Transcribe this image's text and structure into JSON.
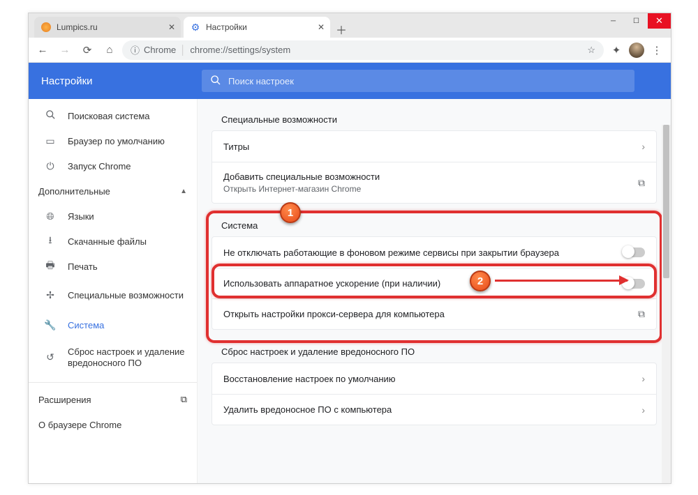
{
  "window": {
    "tabs": [
      {
        "title": "Lumpics.ru",
        "active": false
      },
      {
        "title": "Настройки",
        "active": true
      }
    ]
  },
  "toolbar": {
    "chrome_label": "Chrome",
    "url": "chrome://settings/system"
  },
  "header": {
    "title": "Настройки",
    "search_placeholder": "Поиск настроек"
  },
  "sidebar": {
    "items": [
      {
        "icon": "search",
        "label": "Поисковая система"
      },
      {
        "icon": "browser",
        "label": "Браузер по умолчанию"
      },
      {
        "icon": "power",
        "label": "Запуск Chrome"
      }
    ],
    "advanced_label": "Дополнительные",
    "advanced_items": [
      {
        "icon": "globe",
        "label": "Языки"
      },
      {
        "icon": "download",
        "label": "Скачанные файлы"
      },
      {
        "icon": "print",
        "label": "Печать"
      },
      {
        "icon": "a11y",
        "label": "Специальные возможности"
      },
      {
        "icon": "wrench",
        "label": "Система",
        "active": true
      },
      {
        "icon": "reset",
        "label": "Сброс настроек и удаление вредоносного ПО"
      }
    ],
    "extensions_label": "Расширения",
    "about_label": "О браузере Chrome"
  },
  "sections": {
    "accessibility": {
      "title": "Специальные возможности",
      "rows": [
        {
          "label": "Титры"
        },
        {
          "label": "Добавить специальные возможности",
          "sub": "Открыть Интернет-магазин Chrome"
        }
      ]
    },
    "system": {
      "title": "Система",
      "rows": [
        {
          "label": "Не отключать работающие в фоновом режиме сервисы при закрытии браузера"
        },
        {
          "label": "Использовать аппаратное ускорение (при наличии)"
        },
        {
          "label": "Открыть настройки прокси-сервера для компьютера"
        }
      ]
    },
    "reset": {
      "title": "Сброс настроек и удаление вредоносного ПО",
      "rows": [
        {
          "label": "Восстановление настроек по умолчанию"
        },
        {
          "label": "Удалить вредоносное ПО с компьютера"
        }
      ]
    }
  },
  "annotations": {
    "marker1": "1",
    "marker2": "2"
  }
}
